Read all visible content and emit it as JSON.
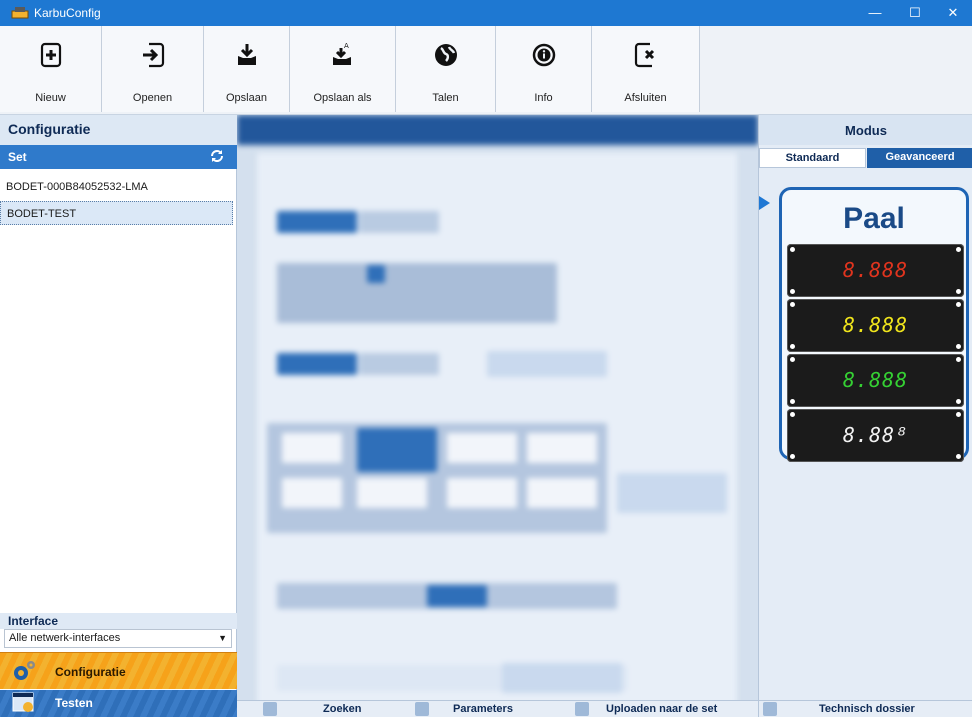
{
  "window": {
    "title": "KarbuConfig",
    "controls": [
      "—",
      "☐",
      "✕"
    ]
  },
  "toolbar": {
    "items": [
      {
        "label": "Nieuw",
        "icon": "new-icon"
      },
      {
        "label": "Openen",
        "icon": "open-icon"
      },
      {
        "label": "Opslaan",
        "icon": "save-icon"
      },
      {
        "label": "Opslaan als",
        "icon": "save-as-icon"
      },
      {
        "label": "Talen",
        "icon": "globe-icon"
      },
      {
        "label": "Info",
        "icon": "info-icon"
      },
      {
        "label": "Afsluiten",
        "icon": "exit-icon"
      }
    ]
  },
  "left": {
    "header": "Configuratie",
    "set_label": "Set",
    "sets": [
      "BODET-000B84052532-LMA",
      "BODET-TEST"
    ],
    "selected_set": "BODET-TEST",
    "interface_label": "Interface",
    "interface_value": "Alle netwerk-interfaces",
    "nav": {
      "config": "Configuratie",
      "test": "Testen"
    }
  },
  "footer": {
    "search": "Zoeken",
    "parameters": "Parameters",
    "upload": "Uploaden naar de set"
  },
  "right": {
    "header": "Modus",
    "mode_standard": "Standaard",
    "mode_advanced": "Geavanceerd",
    "active_mode": "Geavanceerd",
    "paal_label": "Paal",
    "displays": [
      {
        "text": "8.888",
        "color": "#e0341e"
      },
      {
        "text": "8.888",
        "color": "#f0e51c"
      },
      {
        "text": "8.888",
        "color": "#35d033"
      },
      {
        "text": "8.88⁸",
        "color": "#f2f2f2"
      }
    ],
    "tech_label": "Technisch dossier"
  },
  "colors": {
    "accent": "#1e78d2",
    "nav_orange": "#f6a21a",
    "nav_blue": "#2f6fb9"
  }
}
